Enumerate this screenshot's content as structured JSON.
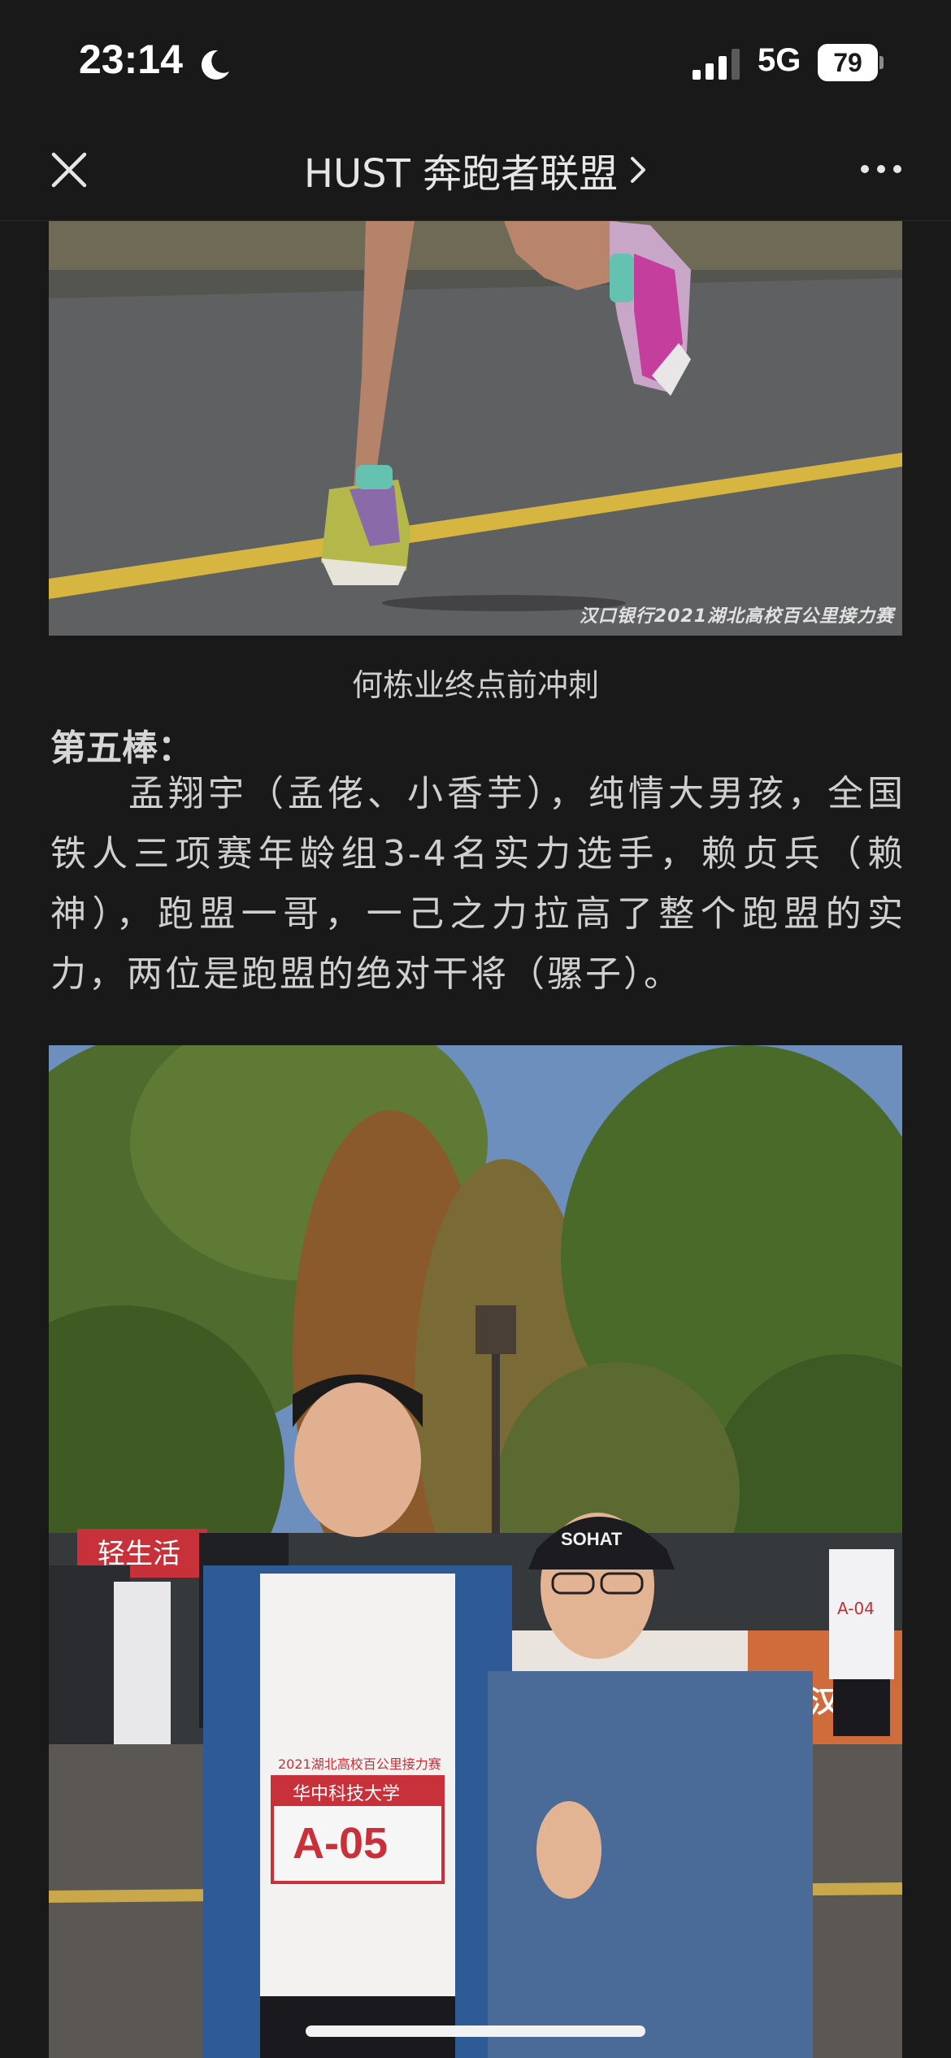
{
  "status_bar": {
    "time": "23:14",
    "network": "5G",
    "battery": "79",
    "icons": [
      "moon-icon",
      "signal-icon",
      "battery-icon"
    ]
  },
  "nav": {
    "title": "HUST 奔跑者联盟",
    "close_icon": "close-icon",
    "more_icon": "more-icon",
    "chevron_icon": "chevron-right-icon"
  },
  "article": {
    "photo1": {
      "watermark": "汉口银行2021湖北高校百公里接力赛"
    },
    "caption": "何栋业终点前冲刺",
    "section_heading": "第五棒：",
    "paragraph": "孟翔宇（孟佬、小香芋），纯情大男孩，全国铁人三项赛年龄组3-4名实力选手，赖贞兵（赖神），跑盟一哥，一己之力拉高了整个跑盟的实力，两位是跑盟的绝对干将（骡子）。",
    "photo2": {
      "banner_text": "轻生活",
      "bib_school": "华中科技大学",
      "bib_number": "A-05",
      "bib_event": "2021湖北高校百公里接力赛",
      "hat_text": "SOHAT",
      "sign_text": "武汉理",
      "side_bib": "A-04"
    }
  },
  "colors": {
    "background": "#191919",
    "text": "#cfcfcf",
    "title": "#e6e6e6"
  }
}
